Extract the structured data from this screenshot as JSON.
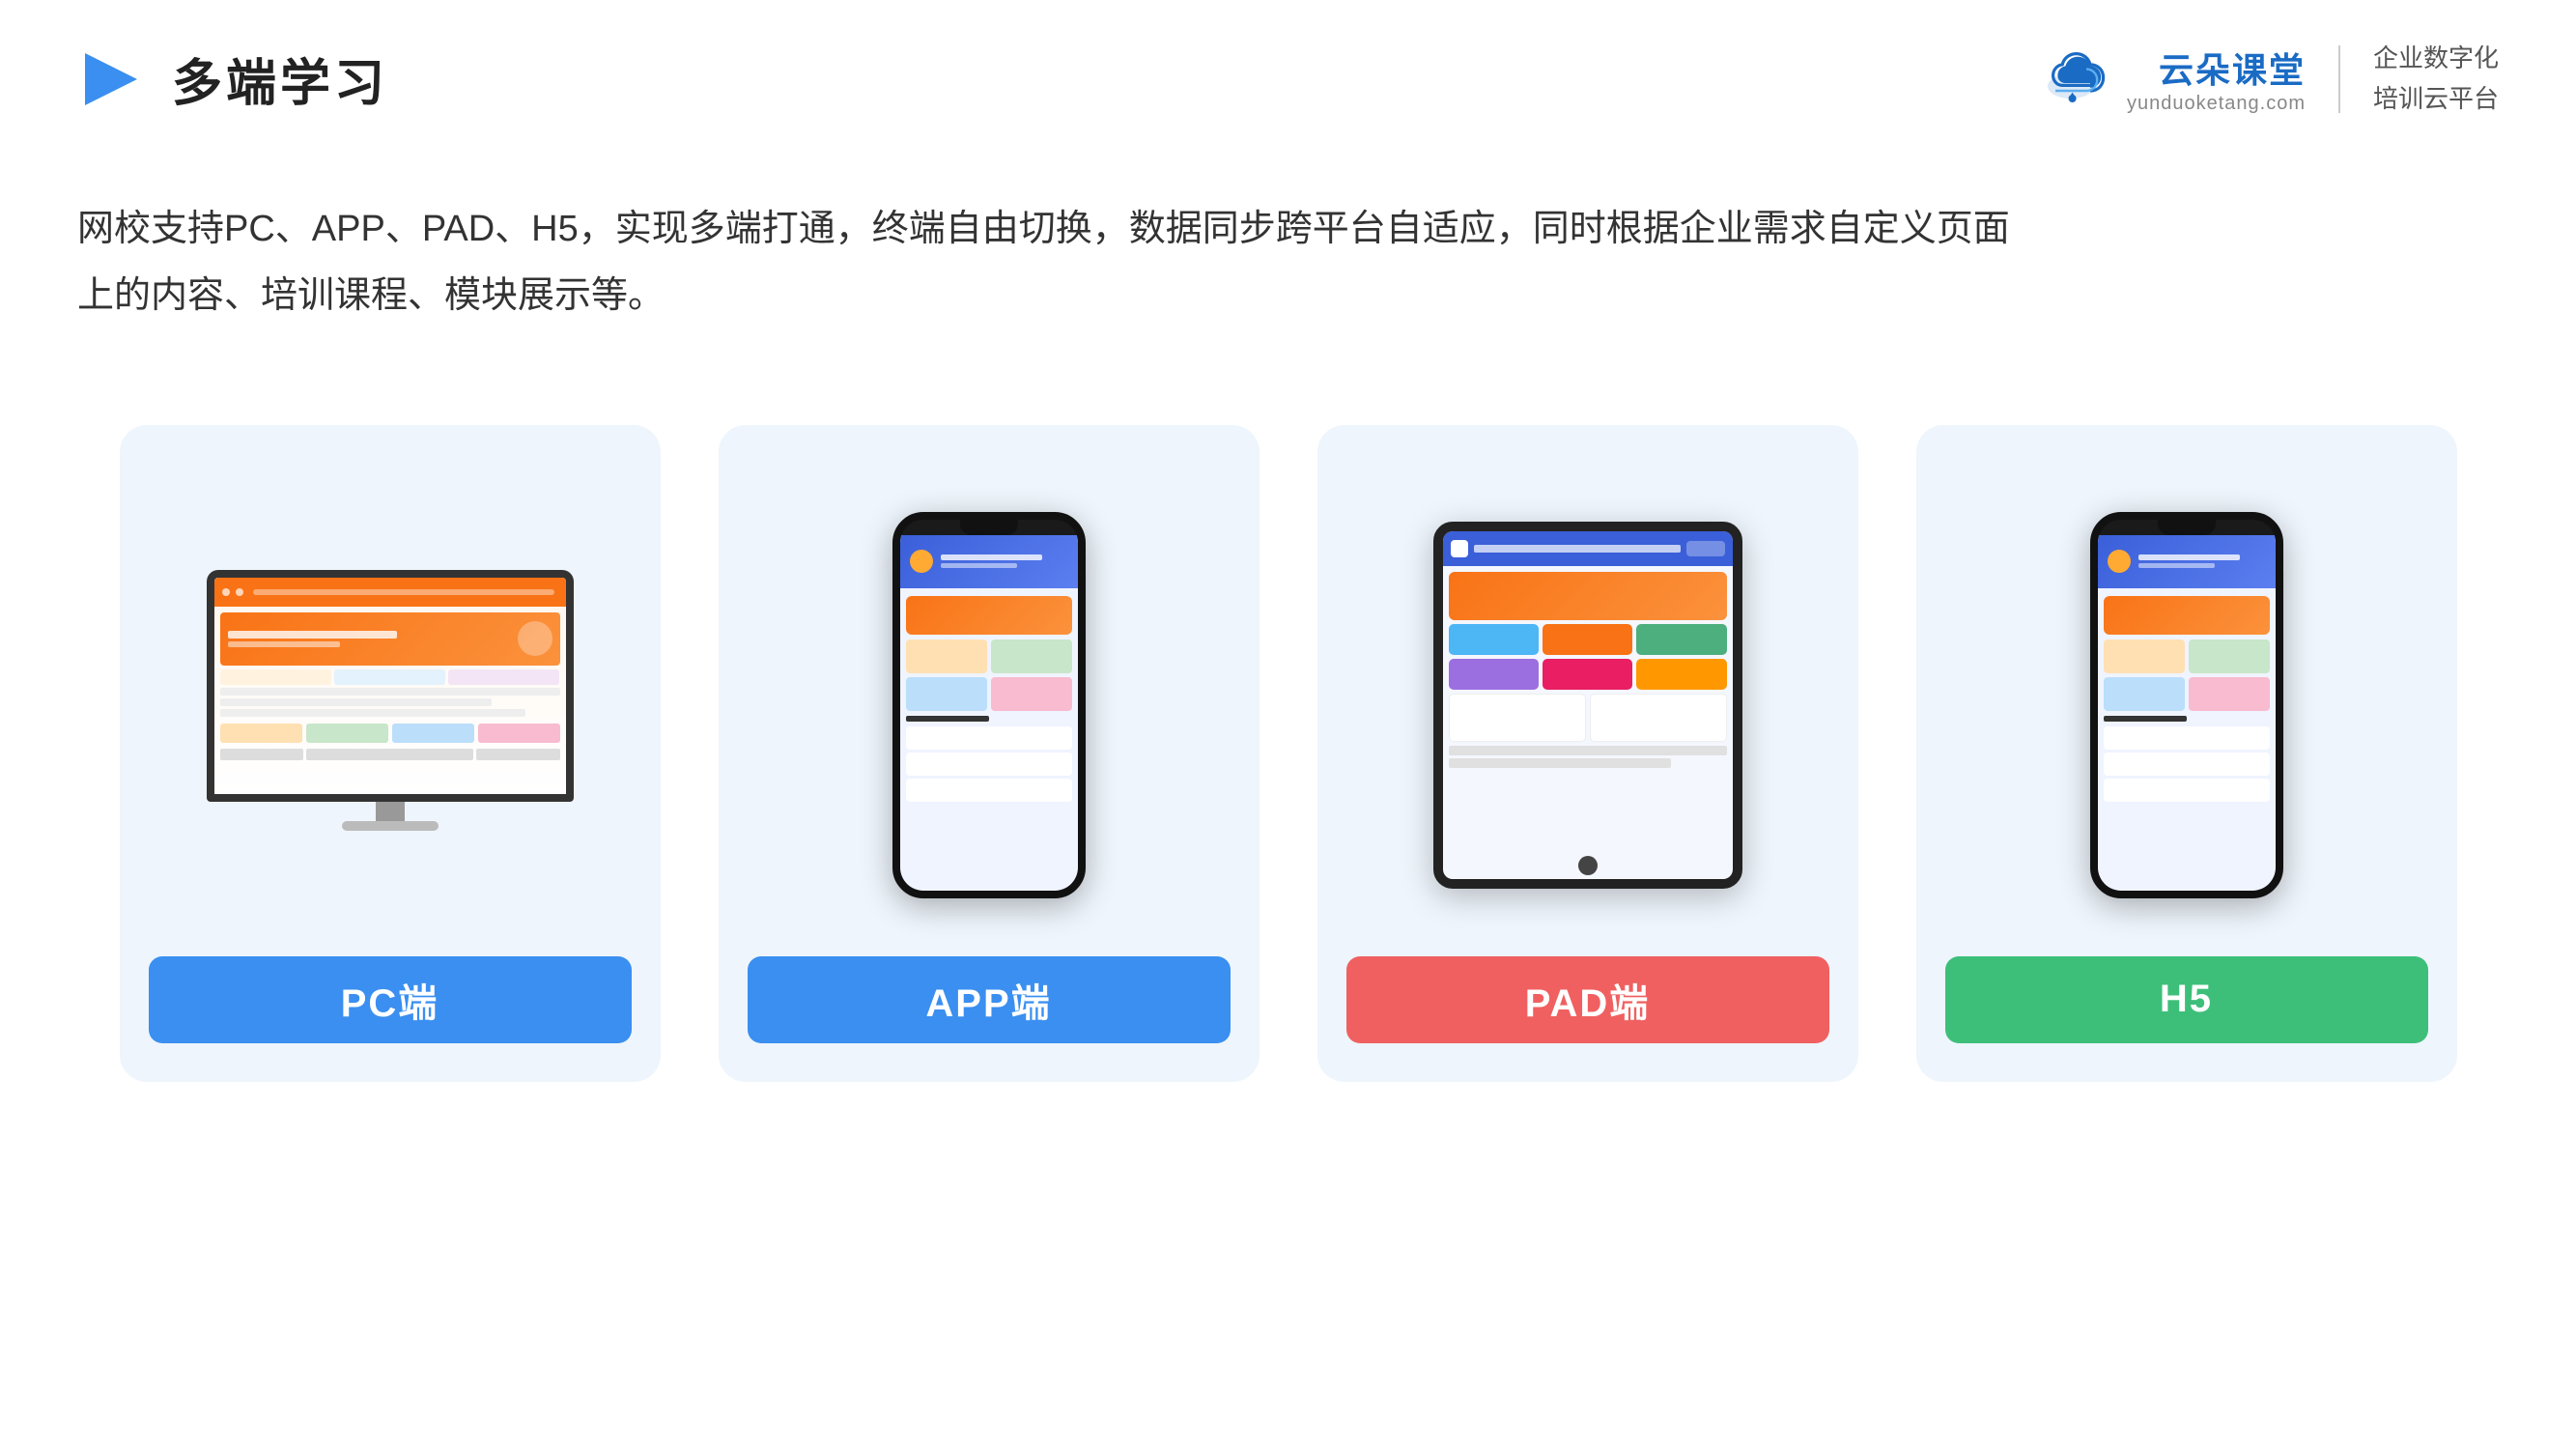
{
  "header": {
    "title": "多端学习",
    "brand": {
      "name_cn": "云朵课堂",
      "url": "yunduoketang.com",
      "slogan_line1": "企业数字化",
      "slogan_line2": "培训云平台"
    }
  },
  "description": {
    "text_line1": "网校支持PC、APP、PAD、H5，实现多端打通，终端自由切换，数据同步跨平台自适应，同时根据企业需求自定义页面",
    "text_line2": "上的内容、培训课程、模块展示等。"
  },
  "cards": [
    {
      "id": "pc",
      "label": "PC端",
      "label_color": "blue",
      "device_type": "monitor"
    },
    {
      "id": "app",
      "label": "APP端",
      "label_color": "blue",
      "device_type": "phone"
    },
    {
      "id": "pad",
      "label": "PAD端",
      "label_color": "red",
      "device_type": "tablet"
    },
    {
      "id": "h5",
      "label": "H5",
      "label_color": "green",
      "device_type": "phone2"
    }
  ],
  "colors": {
    "blue_label": "#3a8ff0",
    "red_label": "#f06060",
    "green_label": "#3dbf7a",
    "card_bg": "#eef5fc",
    "brand_blue": "#1a6bc4"
  }
}
